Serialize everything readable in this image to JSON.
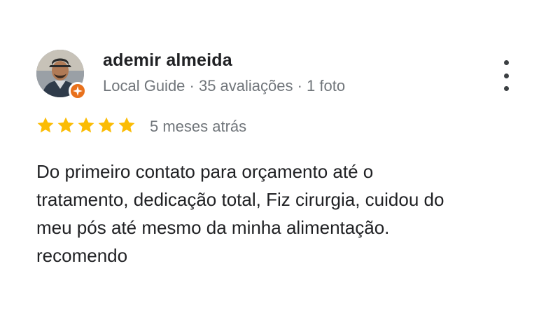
{
  "reviewer": {
    "name": "ademir almeida",
    "meta": "Local Guide · 35 avaliações · 1 foto",
    "avatar_icon": "person-photo",
    "badge_icon": "local-guide-star-icon",
    "badge_color": "#e8711c"
  },
  "rating": {
    "stars": 5,
    "max": 5,
    "star_color": "#fbbc04",
    "time_ago": "5 meses atrás"
  },
  "review": {
    "lines": [
      "Do primeiro contato para orçamento até o",
      "tratamento, dedicação total, Fiz cirurgia, cuidou do",
      "meu pós até mesmo da minha alimentação.",
      "recomendo"
    ]
  },
  "menu": {
    "icon": "more-vert-icon"
  }
}
